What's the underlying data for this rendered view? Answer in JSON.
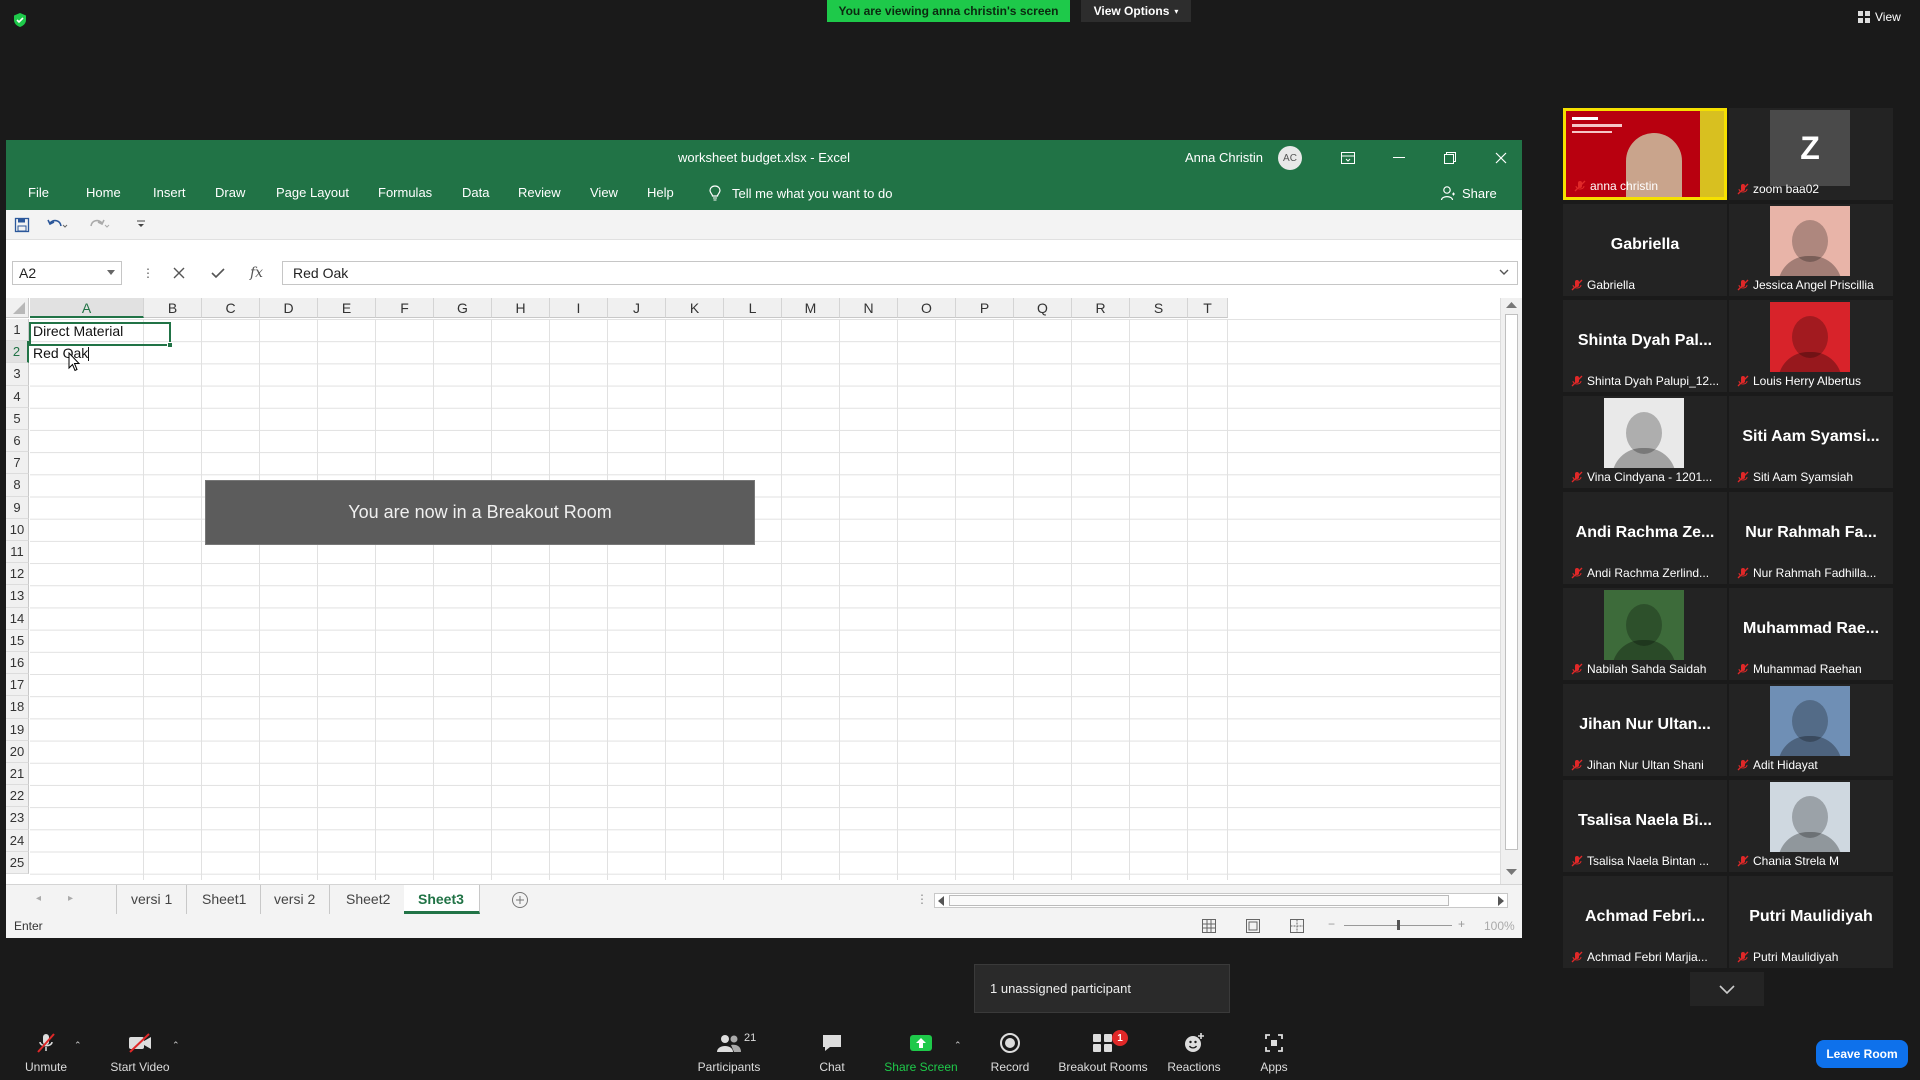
{
  "zoom": {
    "banner": "You are viewing anna christin's screen",
    "view_options": "View Options",
    "view": "View",
    "toast": "You are now in a Breakout Room",
    "unassigned": "1 unassigned participant",
    "leave_room": "Leave Room"
  },
  "excel": {
    "title": "worksheet budget.xlsx  -  Excel",
    "user": "Anna Christin",
    "user_initials": "AC",
    "tabs": [
      "File",
      "Home",
      "Insert",
      "Draw",
      "Page Layout",
      "Formulas",
      "Data",
      "Review",
      "View",
      "Help"
    ],
    "tell_me": "Tell me what you want to do",
    "share": "Share",
    "name_box": "A2",
    "formula": "Red Oak",
    "columns": [
      "A",
      "B",
      "C",
      "D",
      "E",
      "F",
      "G",
      "H",
      "I",
      "J",
      "K",
      "L",
      "M",
      "N",
      "O",
      "P",
      "Q",
      "R",
      "S",
      "T"
    ],
    "rows": [
      "1",
      "2",
      "3",
      "4",
      "5",
      "6",
      "7",
      "8",
      "9",
      "10",
      "11",
      "12",
      "13",
      "14",
      "15",
      "16",
      "17",
      "18",
      "19",
      "20",
      "21",
      "22",
      "23",
      "24",
      "25"
    ],
    "cells": {
      "A1": "Direct Material",
      "A2": "Red Oak"
    },
    "sheets": [
      "versi 1",
      "Sheet1",
      "versi 2",
      "Sheet2",
      "Sheet3"
    ],
    "active_sheet": "Sheet3",
    "status": "Enter",
    "zoom_level": "100%"
  },
  "participants": [
    {
      "name": "anna christin",
      "display": "",
      "kind": "slide",
      "speaking": true
    },
    {
      "name": "zoom baa02",
      "display": "Z",
      "kind": "letter"
    },
    {
      "name": "Gabriella",
      "display": "Gabriella",
      "kind": "text"
    },
    {
      "name": "Jessica Angel Priscillia",
      "display": "",
      "kind": "photo",
      "color": "#e8b4a8"
    },
    {
      "name": "Shinta Dyah Palupi_12...",
      "display": "Shinta Dyah Pal...",
      "kind": "text"
    },
    {
      "name": "Louis Herry Albertus",
      "display": "",
      "kind": "photo",
      "color": "#d8232a"
    },
    {
      "name": "Vina Cindyana - 1201...",
      "display": "",
      "kind": "photo",
      "color": "#e9e9e9"
    },
    {
      "name": "Siti Aam Syamsiah",
      "display": "Siti Aam Syamsi...",
      "kind": "text"
    },
    {
      "name": "Andi Rachma Zerlind...",
      "display": "Andi Rachma Ze...",
      "kind": "text"
    },
    {
      "name": "Nur Rahmah Fadhilla...",
      "display": "Nur Rahmah Fa...",
      "kind": "text"
    },
    {
      "name": "Nabilah Sahda Saidah",
      "display": "",
      "kind": "photo",
      "color": "#3d6b3a"
    },
    {
      "name": "Muhammad Raehan",
      "display": "Muhammad Rae...",
      "kind": "text"
    },
    {
      "name": "Jihan Nur Ultan Shani",
      "display": "Jihan Nur Ultan...",
      "kind": "text"
    },
    {
      "name": "Adit Hidayat",
      "display": "",
      "kind": "photo",
      "color": "#6f8fb5"
    },
    {
      "name": "Tsalisa Naela Bintan ...",
      "display": "Tsalisa Naela Bi...",
      "kind": "text"
    },
    {
      "name": "Chania Strela M",
      "display": "",
      "kind": "photo",
      "color": "#cfd8e0"
    },
    {
      "name": "Achmad Febri Marjia...",
      "display": "Achmad Febri...",
      "kind": "text"
    },
    {
      "name": "Putri Maulidiyah",
      "display": "Putri Maulidiyah",
      "kind": "text"
    }
  ],
  "toolbar": {
    "unmute": "Unmute",
    "start_video": "Start Video",
    "participants": "Participants",
    "participants_count": "21",
    "chat": "Chat",
    "share_screen": "Share Screen",
    "record": "Record",
    "breakout_rooms": "Breakout Rooms",
    "breakout_badge": "1",
    "reactions": "Reactions",
    "apps": "Apps"
  },
  "colors": {
    "excel_green": "#217346",
    "zoom_green": "#1ec94a",
    "leave_blue": "#0e71eb",
    "speaker_yellow": "#f5e000"
  }
}
